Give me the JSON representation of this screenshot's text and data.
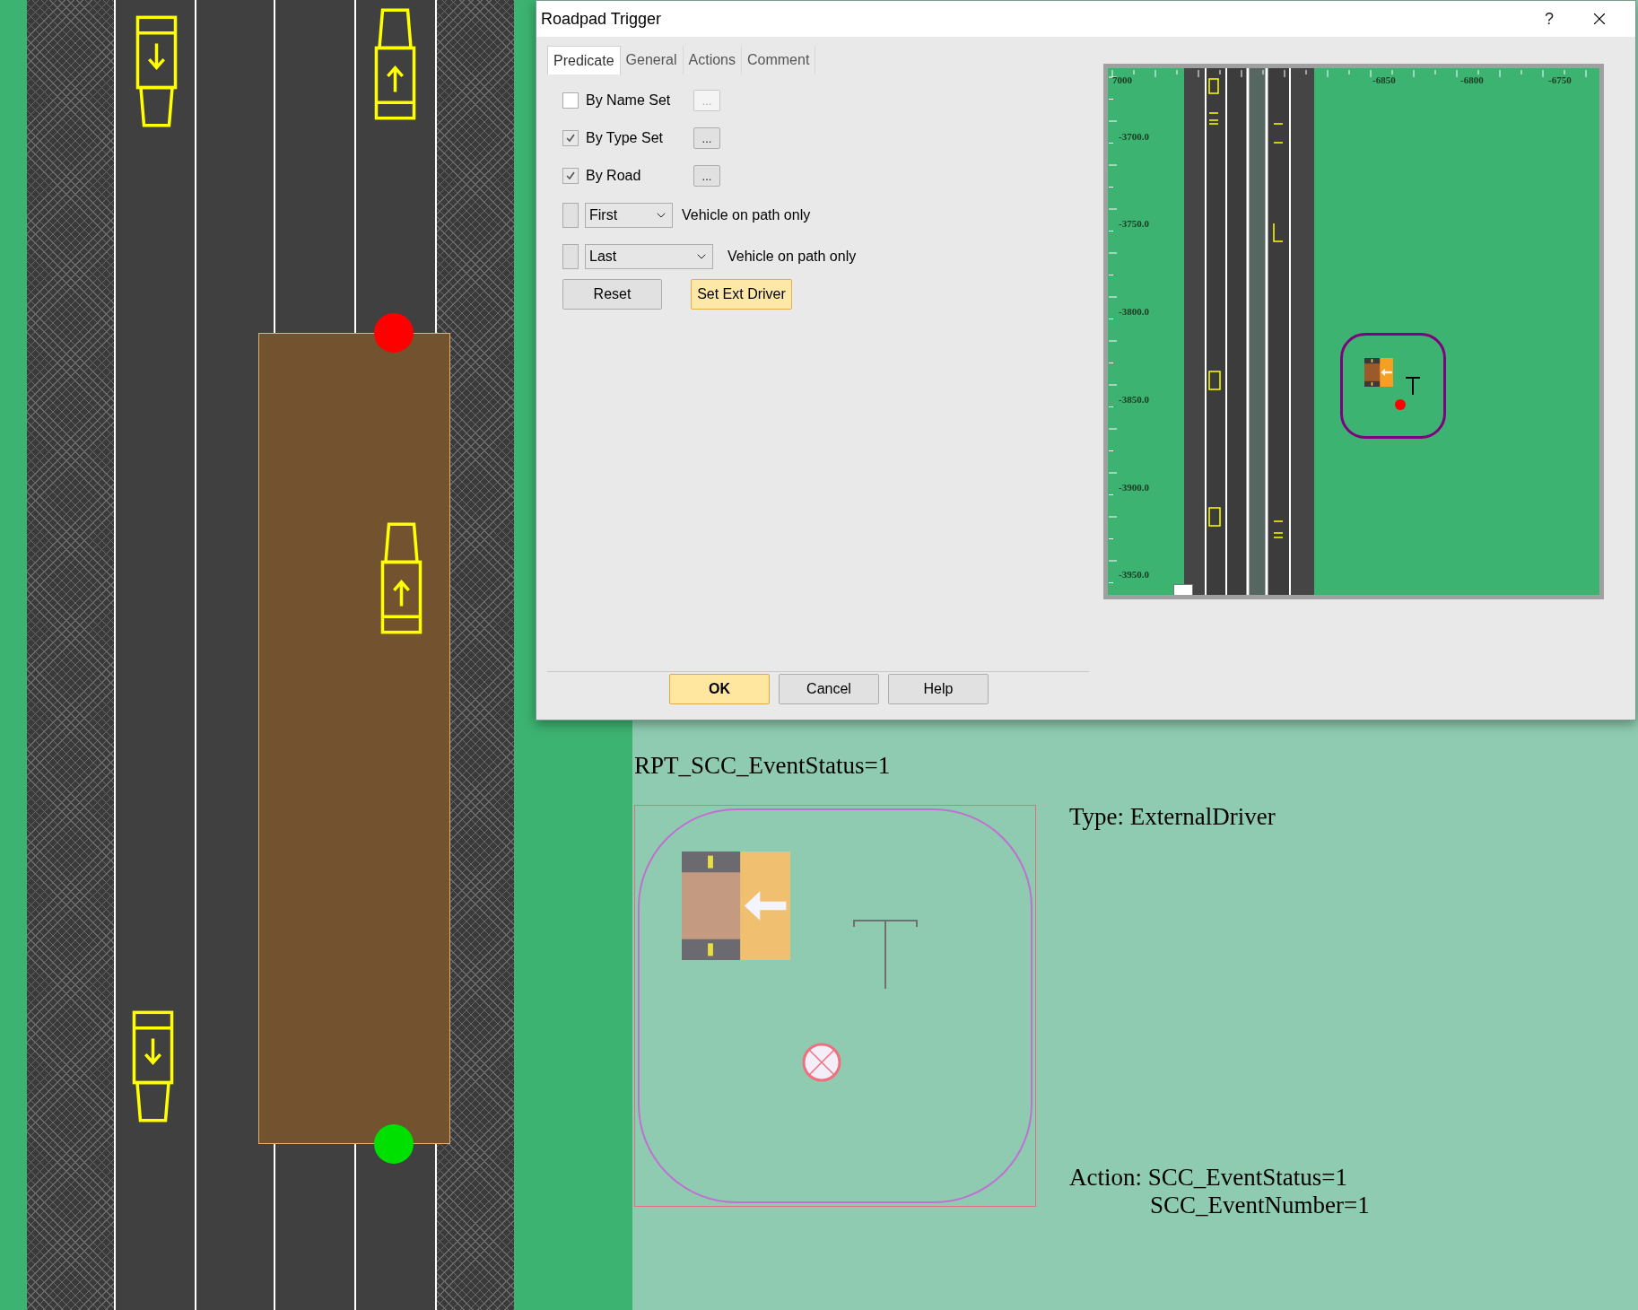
{
  "canvas": {
    "trigger_label": "RPT_SCC_EventStatus=1",
    "type_label": "Type: ExternalDriver",
    "action_lines": [
      "Action: SCC_EventStatus=1",
      "SCC_EventNumber=1"
    ]
  },
  "dialog": {
    "title": "Roadpad Trigger",
    "help_glyph": "?",
    "tabs": [
      {
        "label": "Predicate",
        "selected": true
      },
      {
        "label": "General",
        "selected": false
      },
      {
        "label": "Actions",
        "selected": false
      },
      {
        "label": "Comment",
        "selected": false
      }
    ],
    "options": [
      {
        "kind": "check",
        "label": "By Name Set",
        "checked": false,
        "browse": "...",
        "browse_disabled": true
      },
      {
        "kind": "check",
        "label": "By Type Set",
        "checked": true,
        "browse": "...",
        "browse_disabled": false
      },
      {
        "kind": "check",
        "label": "By Road",
        "checked": true,
        "browse": "...",
        "browse_disabled": false
      },
      {
        "kind": "dropdown",
        "checked": false,
        "choice": "First",
        "caption": "Vehicle on path only"
      },
      {
        "kind": "dropdown",
        "checked": false,
        "choice": "Last",
        "caption": "Vehicle on path only"
      }
    ],
    "actions": [
      {
        "label": "Reset",
        "highlighted": false
      },
      {
        "label": "Set Ext Driver",
        "highlighted": true
      }
    ],
    "buttons": [
      {
        "label": "OK",
        "default": true
      },
      {
        "label": "Cancel",
        "default": false
      },
      {
        "label": "Help",
        "default": false
      }
    ],
    "map": {
      "x_labels": [
        "7000",
        "-6850",
        "-6800",
        "-6750"
      ],
      "y_labels": [
        "-3700.0",
        "-3750.0",
        "-3800.0",
        "-3850.0",
        "-3900.0",
        "-3950.0"
      ]
    }
  }
}
